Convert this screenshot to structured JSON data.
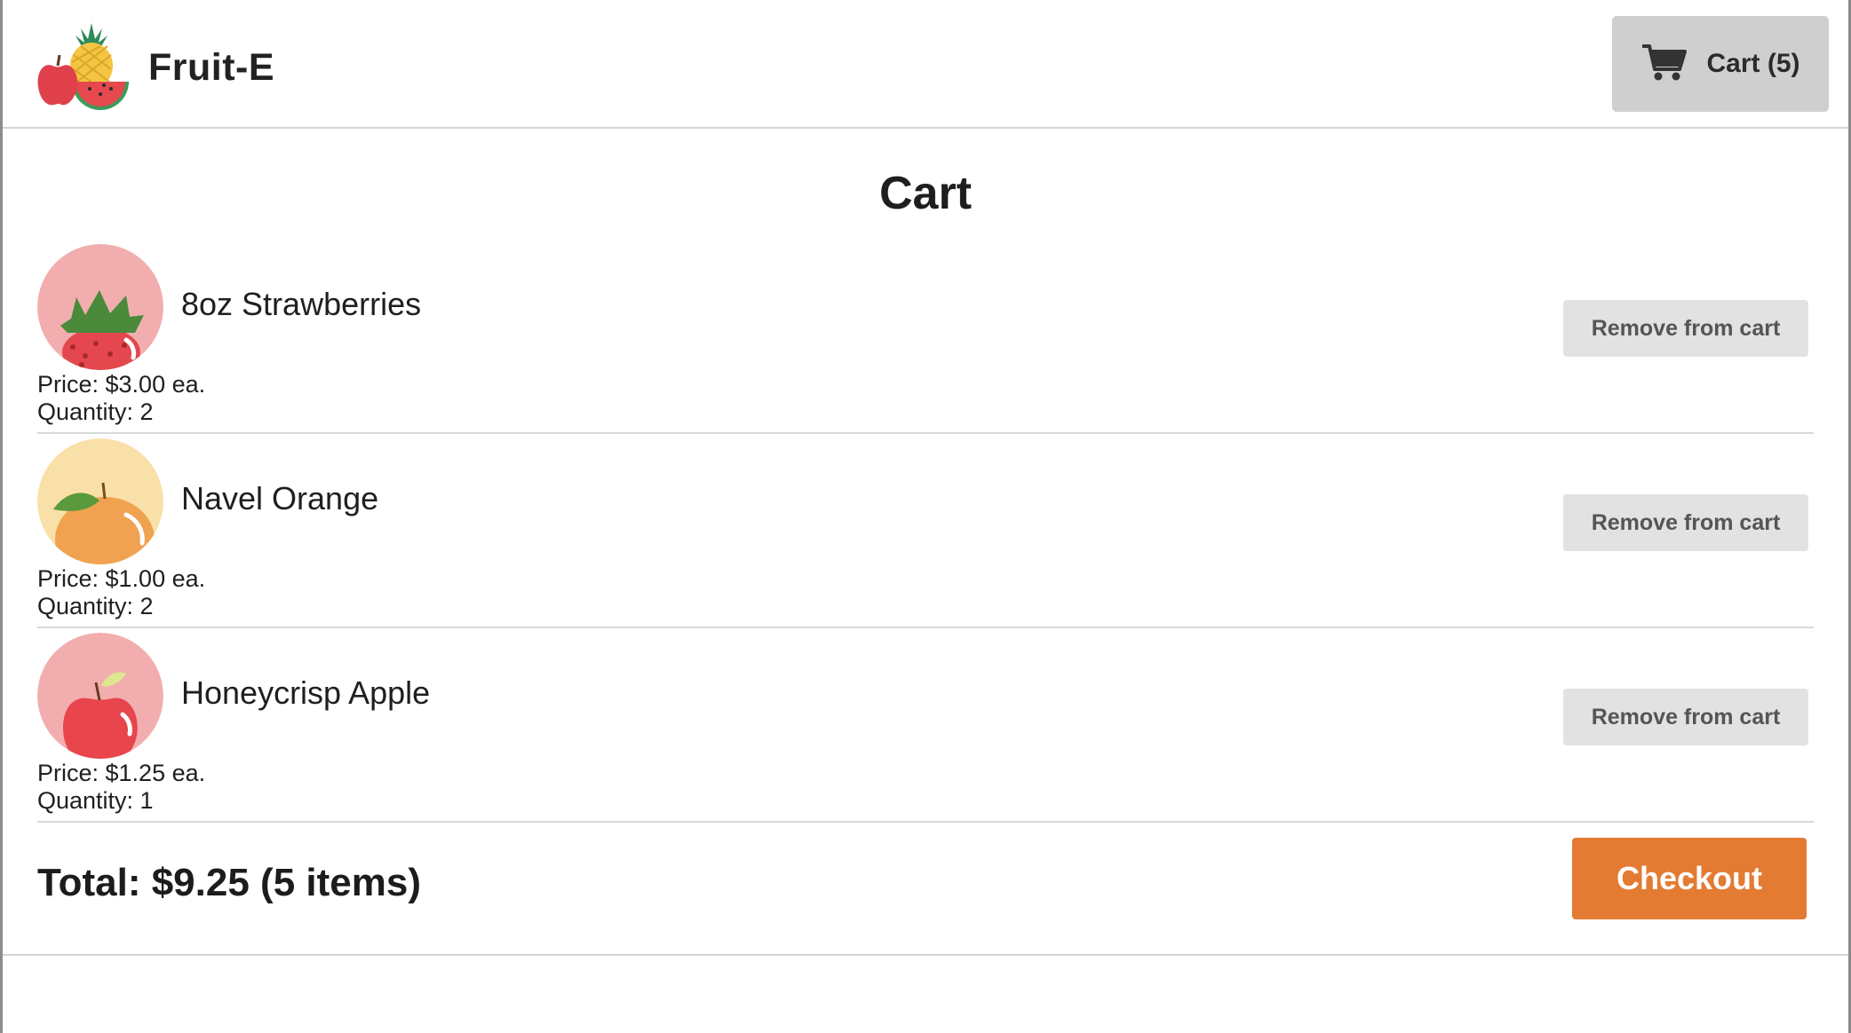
{
  "header": {
    "brand": "Fruit-E",
    "cart_label": "Cart (5)",
    "icons": {
      "logo": "fruit-basket-logo",
      "cart": "shopping-cart-icon"
    }
  },
  "page": {
    "title": "Cart"
  },
  "items": [
    {
      "name": "8oz Strawberries",
      "price": "Price: $3.00 ea.",
      "quantity": "Quantity: 2",
      "remove_label": "Remove from cart",
      "icon": "strawberry-icon"
    },
    {
      "name": "Navel Orange",
      "price": "Price: $1.00 ea.",
      "quantity": "Quantity: 2",
      "remove_label": "Remove from cart",
      "icon": "orange-icon"
    },
    {
      "name": "Honeycrisp Apple",
      "price": "Price: $1.25 ea.",
      "quantity": "Quantity: 1",
      "remove_label": "Remove from cart",
      "icon": "apple-icon"
    }
  ],
  "summary": {
    "total": "Total: $9.25 (5 items)",
    "checkout_label": "Checkout"
  },
  "colors": {
    "checkout": "#e47b32",
    "cart_button": "#cfcfcf",
    "remove_button": "#e2e2e2",
    "strawberry_bg": "#f2aeae",
    "orange_bg": "#f9e0a8",
    "apple_bg": "#f2aeae"
  }
}
